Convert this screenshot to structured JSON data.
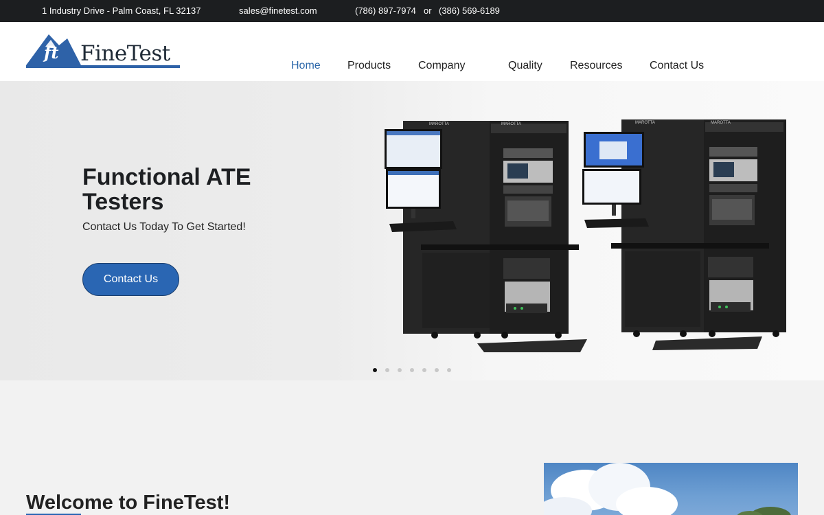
{
  "topbar": {
    "address": "1 Industry Drive - Palm Coast, FL 32137",
    "email": "sales@finetest.com",
    "phone1": "(786) 897-7974",
    "or": "or",
    "phone2": "(386) 569-6189"
  },
  "logo": {
    "mark": "ft",
    "text": "FineTest",
    "icon": "finetest-logo"
  },
  "nav": {
    "items": [
      {
        "label": "Home",
        "active": true
      },
      {
        "label": "Products"
      },
      {
        "label": "Company"
      },
      {
        "label": "Quality"
      },
      {
        "label": "Resources"
      },
      {
        "label": "Contact Us"
      }
    ]
  },
  "hero": {
    "title": "Functional ATE Testers",
    "subtitle": "Contact Us Today To Get Started!",
    "button": "Contact Us",
    "image_icon": "ate-tester-racks-image",
    "rack_brand": "MAROTTA",
    "slides_total": 7,
    "active_slide": 1
  },
  "welcome": {
    "title": "Welcome to FineTest!"
  },
  "colors": {
    "accent": "#2a66b3",
    "topbar": "#1c1e20",
    "nav_active": "#2a66a9"
  }
}
